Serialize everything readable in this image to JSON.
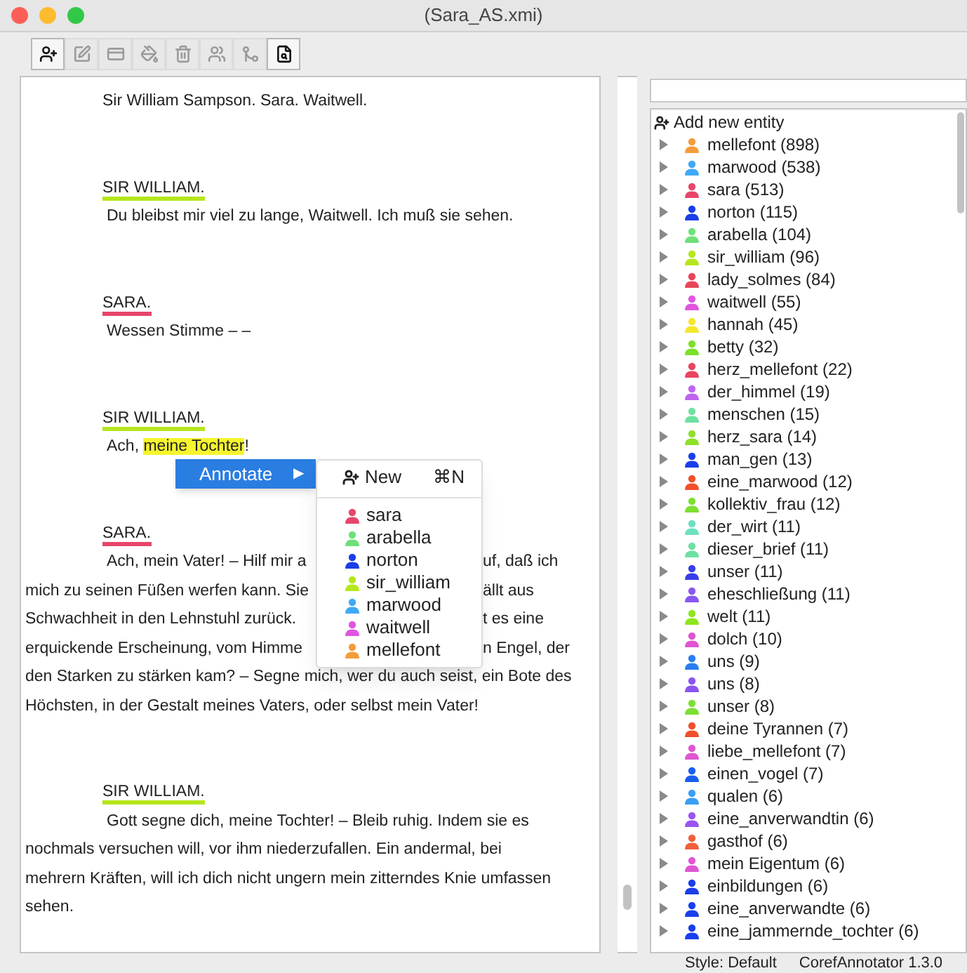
{
  "window": {
    "title": "(Sara_AS.xmi)"
  },
  "toolbar": [
    {
      "kind": "add-entity",
      "disabled": false
    },
    {
      "kind": "rename",
      "disabled": true
    },
    {
      "kind": "keyboard",
      "disabled": true
    },
    {
      "kind": "color",
      "disabled": true
    },
    {
      "kind": "delete",
      "disabled": true
    },
    {
      "kind": "group",
      "disabled": true
    },
    {
      "kind": "merge",
      "disabled": true
    },
    {
      "kind": "search",
      "disabled": false
    }
  ],
  "document": {
    "blocks": [
      {
        "kind": "stage",
        "lines": [
          {
            "parts": [
              {
                "text": "Sir William Sampson. Sara. Waitwell.",
                "highlighted": false
              }
            ]
          }
        ]
      },
      {
        "kind": "speaker",
        "text": "SIR WILLIAM.",
        "color": "#b5e61d"
      },
      {
        "kind": "speech",
        "lines": [
          {
            "parts": [
              {
                "text": "Du bleibst mir viel zu lange, Waitwell. Ich muß sie sehen.",
                "highlighted": false
              }
            ]
          }
        ]
      },
      {
        "kind": "speaker",
        "text": "SARA.",
        "color": "#e8456a"
      },
      {
        "kind": "speech",
        "lines": [
          {
            "parts": [
              {
                "text": "Wessen Stimme – –",
                "highlighted": false
              }
            ]
          }
        ]
      },
      {
        "kind": "speaker",
        "text": "SIR WILLIAM.",
        "color": "#b5e61d"
      },
      {
        "kind": "speech",
        "lines": [
          {
            "parts": [
              {
                "text": "Ach, ",
                "highlighted": false
              },
              {
                "text": "meine Tochter",
                "highlighted": true
              },
              {
                "text": "!",
                "highlighted": false
              }
            ]
          }
        ]
      },
      {
        "kind": "speaker",
        "text": "SARA.",
        "color": "#e8456a"
      },
      {
        "kind": "speech",
        "lines": [
          {
            "parts": [
              {
                "text": "Ach, mein Vater! – Hilf mir a",
                "highlighted": false
              }
            ],
            "after_menu": "uf, daß ich"
          },
          {
            "parts": [
              {
                "text": "mich zu seinen Füßen werfen kann. Sie",
                "highlighted": false
              }
            ],
            "after_menu": "ällt aus"
          },
          {
            "parts": [
              {
                "text": "Schwachheit in den Lehnstuhl zurück.",
                "highlighted": false
              }
            ],
            "after_menu": "t es eine"
          },
          {
            "parts": [
              {
                "text": "erquickende Erscheinung, vom Himme",
                "highlighted": false
              }
            ],
            "after_menu": "n Engel, der"
          },
          {
            "parts": [
              {
                "text": "den Starken zu stärken kam? – Segne mich, wer du auch seist, ein Bote des",
                "highlighted": false
              }
            ]
          },
          {
            "parts": [
              {
                "text": "Höchsten, in der Gestalt meines Vaters, oder selbst mein Vater!",
                "highlighted": false
              }
            ]
          }
        ]
      },
      {
        "kind": "speaker",
        "text": "SIR WILLIAM.",
        "color": "#b5e61d"
      },
      {
        "kind": "speech",
        "lines": [
          {
            "parts": [
              {
                "text": "Gott segne dich, meine Tochter! – Bleib ruhig. Indem sie es",
                "highlighted": false
              }
            ]
          },
          {
            "parts": [
              {
                "text": "nochmals versuchen will, vor ihm niederzufallen. Ein andermal, bei",
                "highlighted": false
              }
            ]
          },
          {
            "parts": [
              {
                "text": "mehrern Kräften, will ich dich nicht ungern mein zitterndes Knie umfassen",
                "highlighted": false
              }
            ]
          },
          {
            "parts": [
              {
                "text": "sehen.",
                "highlighted": false
              }
            ]
          }
        ]
      }
    ]
  },
  "context_menu": {
    "label": "Annotate",
    "arrow": "▶",
    "selected": true,
    "submenu": {
      "new_label": "New",
      "new_shortcut": "⌘N",
      "entities": [
        {
          "name": "sara",
          "color": "#e8456a"
        },
        {
          "name": "arabella",
          "color": "#6ee07a"
        },
        {
          "name": "norton",
          "color": "#1a3ee8"
        },
        {
          "name": "sir_william",
          "color": "#b5e61d"
        },
        {
          "name": "marwood",
          "color": "#3fa9f5"
        },
        {
          "name": "waitwell",
          "color": "#e055e0"
        },
        {
          "name": "mellefont",
          "color": "#f39c3c"
        }
      ]
    }
  },
  "entity_panel": {
    "add_label": "Add new entity",
    "entities": [
      {
        "label": "mellefont (898)",
        "color": "#f39c3c"
      },
      {
        "label": "marwood (538)",
        "color": "#3fa9f5"
      },
      {
        "label": "sara (513)",
        "color": "#e8456a"
      },
      {
        "label": "norton (115)",
        "color": "#1a3ee8"
      },
      {
        "label": "arabella (104)",
        "color": "#6ee07a"
      },
      {
        "label": "sir_william (96)",
        "color": "#b5e61d"
      },
      {
        "label": "lady_solmes (84)",
        "color": "#e8455a"
      },
      {
        "label": "waitwell (55)",
        "color": "#e055e0"
      },
      {
        "label": "hannah (45)",
        "color": "#f5e62e"
      },
      {
        "label": "betty (32)",
        "color": "#7be02a"
      },
      {
        "label": "herz_mellefont (22)",
        "color": "#e84560"
      },
      {
        "label": "der_himmel (19)",
        "color": "#c063f0"
      },
      {
        "label": "menschen (15)",
        "color": "#6ee0a0"
      },
      {
        "label": "herz_sara (14)",
        "color": "#8ee02a"
      },
      {
        "label": "man_gen (13)",
        "color": "#1a3ee9"
      },
      {
        "label": "eine_marwood (12)",
        "color": "#f0502a"
      },
      {
        "label": "kollektiv_frau (12)",
        "color": "#7be030"
      },
      {
        "label": "der_wirt (11)",
        "color": "#6ee0c0"
      },
      {
        "label": "dieser_brief (11)",
        "color": "#6ee0a2"
      },
      {
        "label": "unser (11)",
        "color": "#3a3ee8"
      },
      {
        "label": "eheschließung (11)",
        "color": "#8a55f0"
      },
      {
        "label": "welt (11)",
        "color": "#8ee61d"
      },
      {
        "label": "dolch (10)",
        "color": "#e055d0"
      },
      {
        "label": "uns (9)",
        "color": "#2a7ef0"
      },
      {
        "label": "uns (8)",
        "color": "#8a55f2"
      },
      {
        "label": "unser (8)",
        "color": "#7be032"
      },
      {
        "label": "deine Tyrannen (7)",
        "color": "#f0502c"
      },
      {
        "label": "liebe_mellefont (7)",
        "color": "#e055d2"
      },
      {
        "label": "einen_vogel (7)",
        "color": "#1a5ef0"
      },
      {
        "label": "qualen (6)",
        "color": "#3a9ef5"
      },
      {
        "label": "eine_anverwandtin (6)",
        "color": "#9a55f0"
      },
      {
        "label": "gasthof (6)",
        "color": "#f0603a"
      },
      {
        "label": "mein Eigentum (6)",
        "color": "#e055d4"
      },
      {
        "label": "einbildungen (6)",
        "color": "#1a3eea"
      },
      {
        "label": "eine_anverwandte (6)",
        "color": "#1a3eeb"
      },
      {
        "label": "eine_jammernde_tochter (6)",
        "color": "#1a3eec"
      }
    ]
  },
  "status_bar": {
    "style": "Style: Default",
    "version": "CorefAnnotator 1.3.0"
  }
}
